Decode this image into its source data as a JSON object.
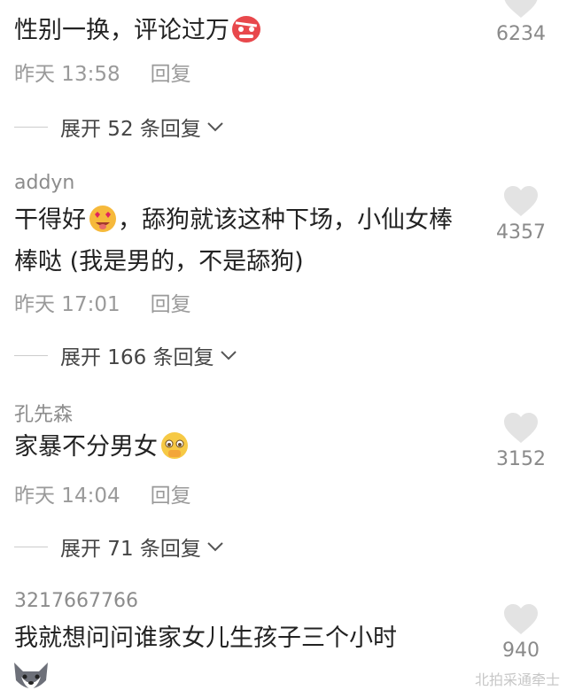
{
  "comments": [
    {
      "text": "性别一换，评论过万",
      "time": "昨天 13:58",
      "reply": "回复",
      "likes": "6234",
      "expand": "展开 52 条回复"
    },
    {
      "username": "addyn",
      "text_a": "干得好",
      "text_b": "，舔狗就该这种下场，小仙女棒棒哒 (我是男的，不是舔狗)",
      "time": "昨天 17:01",
      "reply": "回复",
      "likes": "4357",
      "expand": "展开 166 条回复"
    },
    {
      "username": "孔先森",
      "text": "家暴不分男女",
      "time": "昨天 14:04",
      "reply": "回复",
      "likes": "3152",
      "expand": "展开 71 条回复"
    },
    {
      "username": "3217667766",
      "text": "我就想问问谁家女儿生孩子三个小时",
      "likes": "940"
    }
  ],
  "watermark": "北拍采通牵士",
  "colors": {
    "heart": "#e3e3e3",
    "text": "#222222",
    "meta": "#9a9a9a"
  }
}
